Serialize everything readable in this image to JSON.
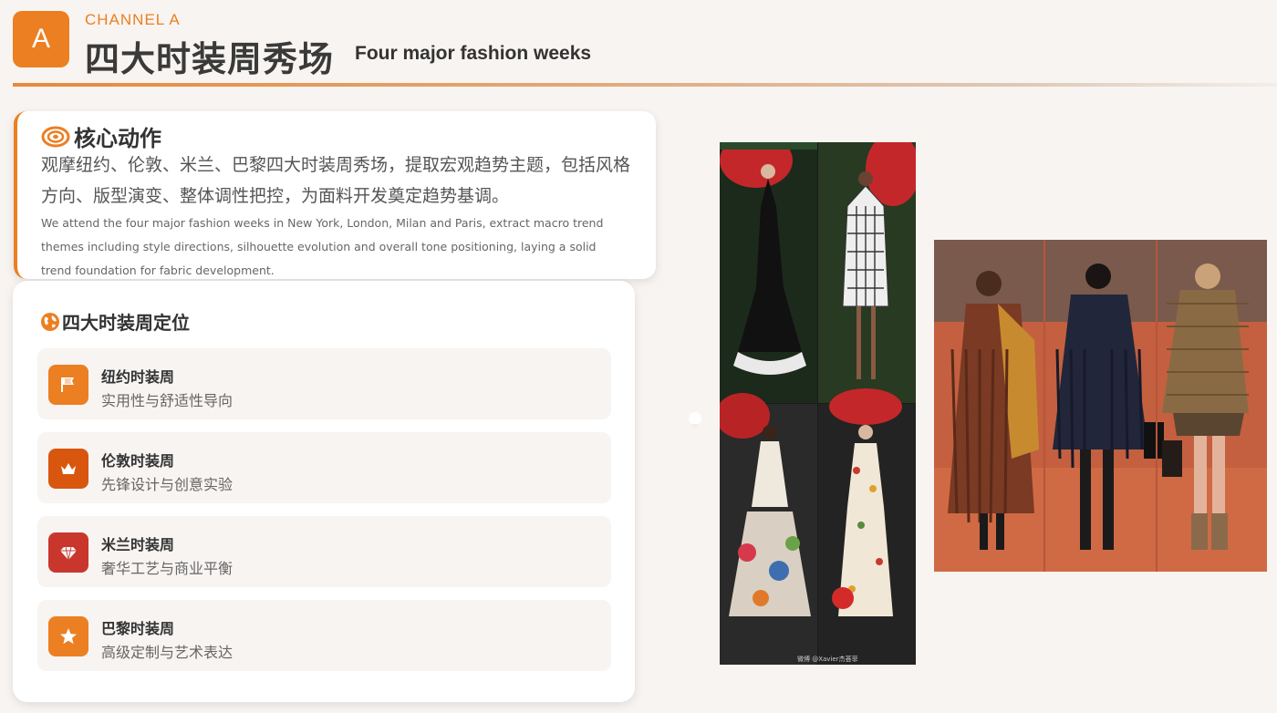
{
  "header": {
    "badge": "A",
    "channel": "CHANNEL A",
    "title_cn": "四大时装周秀场",
    "title_en": "Four major fashion weeks"
  },
  "core": {
    "heading": "核心动作",
    "text_cn": "观摩纽约、伦敦、米兰、巴黎四大时装周秀场，提取宏观趋势主题，包括风格方向、版型演变、整体调性把控，为面料开发奠定趋势基调。",
    "text_en": "We attend the four major fashion weeks in New York, London, Milan and Paris, extract macro trend themes including style directions, silhouette evolution and overall tone positioning, laying a solid trend foundation for fabric development."
  },
  "positioning": {
    "heading": "四大时装周定位",
    "items": [
      {
        "name": "纽约时装周",
        "desc": "实用性与舒适性导向",
        "icon": "flag-icon",
        "color": "#ec7f21"
      },
      {
        "name": "伦敦时装周",
        "desc": "先锋设计与创意实验",
        "icon": "crown-icon",
        "color": "#d9560f"
      },
      {
        "name": "米兰时装周",
        "desc": "奢华工艺与商业平衡",
        "icon": "diamond-icon",
        "color": "#c9372c"
      },
      {
        "name": "巴黎时装周",
        "desc": "高级定制与艺术表达",
        "icon": "star-icon",
        "color": "#ec7f21"
      }
    ]
  },
  "photos": {
    "watermark": "微博 @Xavier杰荟菲"
  },
  "colors": {
    "accent": "#ec7f21",
    "background": "#f8f4f1"
  }
}
